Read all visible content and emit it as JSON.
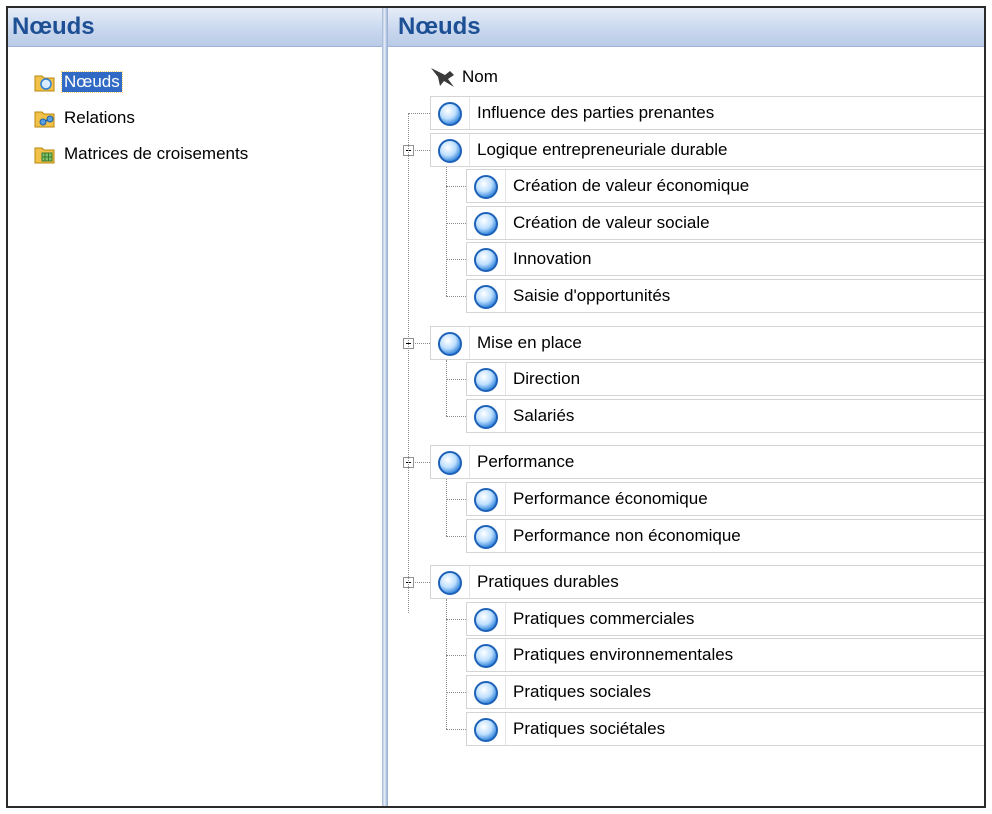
{
  "left_pane": {
    "title": "Nœuds",
    "items": [
      {
        "label": "Nœuds",
        "icon": "nodes-folder-icon",
        "selected": true
      },
      {
        "label": "Relations",
        "icon": "relations-folder-icon",
        "selected": false
      },
      {
        "label": "Matrices de croisements",
        "icon": "matrices-folder-icon",
        "selected": false
      }
    ]
  },
  "right_pane": {
    "title": "Nœuds",
    "column_header": "Nom",
    "nodes": [
      {
        "label": "Influence des parties prenantes",
        "level": 0,
        "expandable": false
      },
      {
        "label": "Logique entrepreneuriale durable",
        "level": 0,
        "expandable": true
      },
      {
        "label": "Création de valeur économique",
        "level": 1
      },
      {
        "label": "Création de valeur sociale",
        "level": 1
      },
      {
        "label": "Innovation",
        "level": 1
      },
      {
        "label": "Saisie d'opportunités",
        "level": 1
      },
      {
        "label": "Mise en place",
        "level": 0,
        "expandable": true
      },
      {
        "label": "Direction",
        "level": 1
      },
      {
        "label": "Salariés",
        "level": 1
      },
      {
        "label": "Performance",
        "level": 0,
        "expandable": true
      },
      {
        "label": "Performance économique",
        "level": 1
      },
      {
        "label": "Performance non économique",
        "level": 1
      },
      {
        "label": "Pratiques durables",
        "level": 0,
        "expandable": true
      },
      {
        "label": "Pratiques commerciales",
        "level": 1
      },
      {
        "label": "Pratiques environnementales",
        "level": 1
      },
      {
        "label": "Pratiques sociales",
        "level": 1
      },
      {
        "label": "Pratiques sociétales",
        "level": 1
      }
    ]
  },
  "colors": {
    "header_text": "#1d4f94",
    "selection": "#316ac5",
    "node_icon": "#2a7fd9"
  }
}
